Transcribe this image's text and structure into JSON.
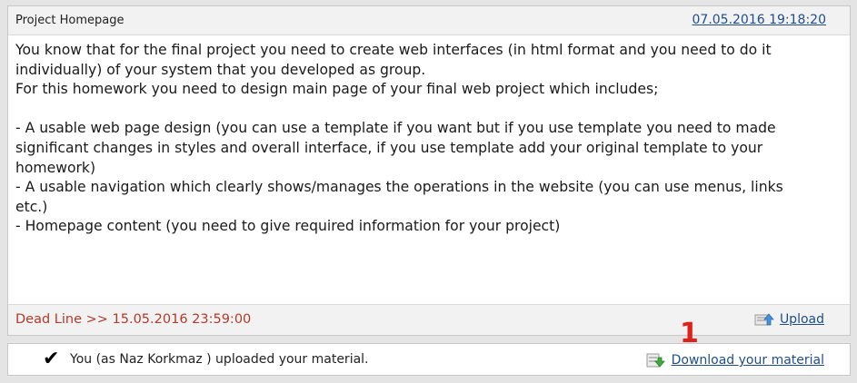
{
  "card": {
    "title": "Project Homepage",
    "timestamp": "07.05.2016 19:18:20",
    "body_lines": [
      "You know that for the final project you need to create web interfaces (in html format and you need to do it",
      "individually) of your system that you developed as group.",
      "For this homework you need to design main page of your final web project which includes;",
      "",
      "- A usable web page design (you can use a template if you want but if you use template you need to made",
      "significant changes in styles and overall interface, if you use template add your original template to your",
      "homework)",
      "- A usable navigation which clearly shows/manages the operations in the website (you can use menus, links",
      "etc.)",
      "- Homepage content (you need to give required information for your project)"
    ],
    "deadline": "Dead Line >> 15.05.2016 23:59:00",
    "upload_label": "Upload",
    "upload_icon": "upload-icon"
  },
  "status": {
    "message": "You (as Naz Korkmaz ) uploaded your material.",
    "check_icon": "checkmark-icon",
    "download_label": "Download your material",
    "download_icon": "download-icon"
  },
  "annotation": {
    "marker": "1",
    "color": "#e0201a"
  }
}
